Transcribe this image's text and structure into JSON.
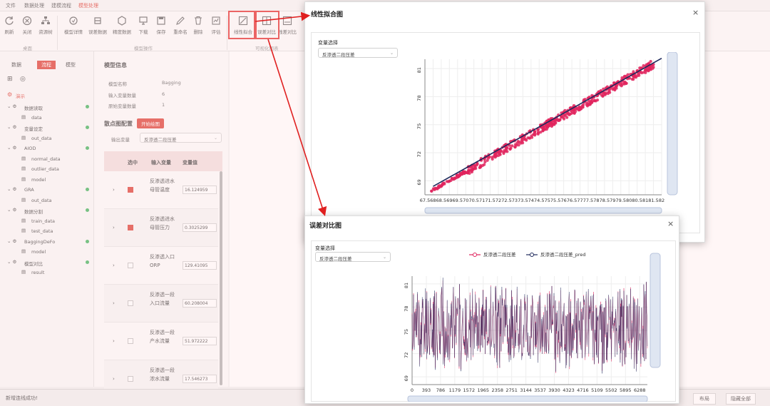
{
  "menubar": {
    "items": [
      "文件",
      "数据处理",
      "建模流程",
      "模型处理"
    ]
  },
  "toolbar": {
    "buttons": [
      {
        "label": "刷新",
        "icon": "refresh-icon"
      },
      {
        "label": "关闭",
        "icon": "close-icon"
      },
      {
        "label": "资源树",
        "icon": "tree-icon"
      },
      {
        "label": "模型详情",
        "icon": "model-detail-icon"
      },
      {
        "label": "误差数据",
        "icon": "error-data-icon"
      },
      {
        "label": "精度数据",
        "icon": "precision-data-icon"
      },
      {
        "label": "下载",
        "icon": "download-icon"
      },
      {
        "label": "保存",
        "icon": "save-icon"
      },
      {
        "label": "重命名",
        "icon": "rename-icon"
      },
      {
        "label": "删除",
        "icon": "delete-icon"
      },
      {
        "label": "评估",
        "icon": "evaluate-icon"
      },
      {
        "label": "线性拟合",
        "icon": "linear-fit-icon"
      },
      {
        "label": "误差对比",
        "icon": "error-compare-icon"
      },
      {
        "label": "残差对比",
        "icon": "residual-compare-icon"
      }
    ],
    "groups": [
      "桌面",
      "模型操作",
      "可视化图表"
    ]
  },
  "sidebar": {
    "tabs": [
      "数据",
      "流程",
      "模型"
    ],
    "root": "演示",
    "nodes": [
      {
        "label": "数据读取",
        "level": 1
      },
      {
        "label": "data",
        "level": 2
      },
      {
        "label": "变量设定",
        "level": 1
      },
      {
        "label": "out_data",
        "level": 2
      },
      {
        "label": "AIOD",
        "level": 1
      },
      {
        "label": "normal_data",
        "level": 2
      },
      {
        "label": "outlier_data",
        "level": 2
      },
      {
        "label": "model",
        "level": 2
      },
      {
        "label": "GRA",
        "level": 1
      },
      {
        "label": "out_data",
        "level": 2
      },
      {
        "label": "数据分割",
        "level": 1
      },
      {
        "label": "train_data",
        "level": 2
      },
      {
        "label": "test_data",
        "level": 2
      },
      {
        "label": "BaggingDeFo",
        "level": 1
      },
      {
        "label": "model",
        "level": 2
      },
      {
        "label": "模型对比",
        "level": 1
      },
      {
        "label": "result",
        "level": 2
      }
    ]
  },
  "info": {
    "title": "模型信息",
    "fields": [
      {
        "label": "模型名称",
        "value": "Bagging"
      },
      {
        "label": "输入变量数量",
        "value": "6"
      },
      {
        "label": "原始变量数量",
        "value": "1"
      }
    ],
    "scatter_title": "散点图配置",
    "start_button": "开始绘图",
    "output_var_label": "输出变量",
    "output_var_value": "反渗透二段压差",
    "grid_headers": [
      "选中",
      "输入变量",
      "变量值"
    ],
    "rows": [
      {
        "name": "反渗透进水母管温度",
        "value": "16.124959",
        "checked": true
      },
      {
        "name": "反渗透进水母管压力",
        "value": "0.3025299",
        "checked": true
      },
      {
        "name": "反渗透入口ORP",
        "value": "129.41095",
        "checked": false
      },
      {
        "name": "反渗透一段入口流量",
        "value": "60.208004",
        "checked": false
      },
      {
        "name": "反渗透一段产水流量",
        "value": "51.972222",
        "checked": false
      },
      {
        "name": "反渗透一段浓水流量",
        "value": "17.546273",
        "checked": false
      }
    ]
  },
  "statusbar": {
    "message": "新增连线成功!",
    "layout_button": "布局",
    "hide_all_button": "隐藏全部"
  },
  "dialog1": {
    "title": "线性拟合图",
    "close": "×",
    "var_label": "变量选择",
    "var_value": "反渗透二段压差"
  },
  "dialog2": {
    "title": "误差对比图",
    "close": "×",
    "var_label": "变量选择",
    "var_value": "反渗透二段压差"
  },
  "colors": {
    "accent": "#d93025",
    "series_true": "#e0245e",
    "series_pred": "#1f2a5c",
    "fit_line": "#1f2a5c"
  },
  "chart_data": [
    {
      "type": "scatter",
      "title": "",
      "x_ticks": [
        "67.5",
        "68",
        "68.5",
        "69",
        "69.5",
        "70",
        "70.5",
        "71",
        "71.5",
        "72",
        "72.5",
        "73",
        "73.5",
        "74",
        "74.5",
        "75",
        "75.5",
        "76",
        "76.5",
        "77",
        "77.5",
        "78",
        "78.5",
        "79",
        "79.5",
        "80",
        "80.5",
        "81",
        "81.5",
        "82"
      ],
      "y_ticks": [
        "69",
        "72",
        "75",
        "78",
        "81"
      ],
      "xlim": [
        67.5,
        82
      ],
      "ylim": [
        67.5,
        82
      ],
      "fit_line": [
        [
          68,
          68.4
        ],
        [
          82,
          82.1
        ]
      ],
      "point_range": [
        67.9,
        81.6
      ],
      "grid": true
    },
    {
      "type": "line",
      "legend": [
        "反渗透二段压差",
        "反渗透二段压差_pred"
      ],
      "legend_position": "top",
      "x_ticks": [
        "0",
        "393",
        "786",
        "1179",
        "1572",
        "1965",
        "2358",
        "2751",
        "3144",
        "3537",
        "3930",
        "4323",
        "4716",
        "5109",
        "5502",
        "5895",
        "6288"
      ],
      "y_ticks": [
        "69",
        "72",
        "75",
        "78",
        "81"
      ],
      "ylim": [
        68,
        82
      ],
      "n_points": 6500,
      "grid": true
    }
  ]
}
